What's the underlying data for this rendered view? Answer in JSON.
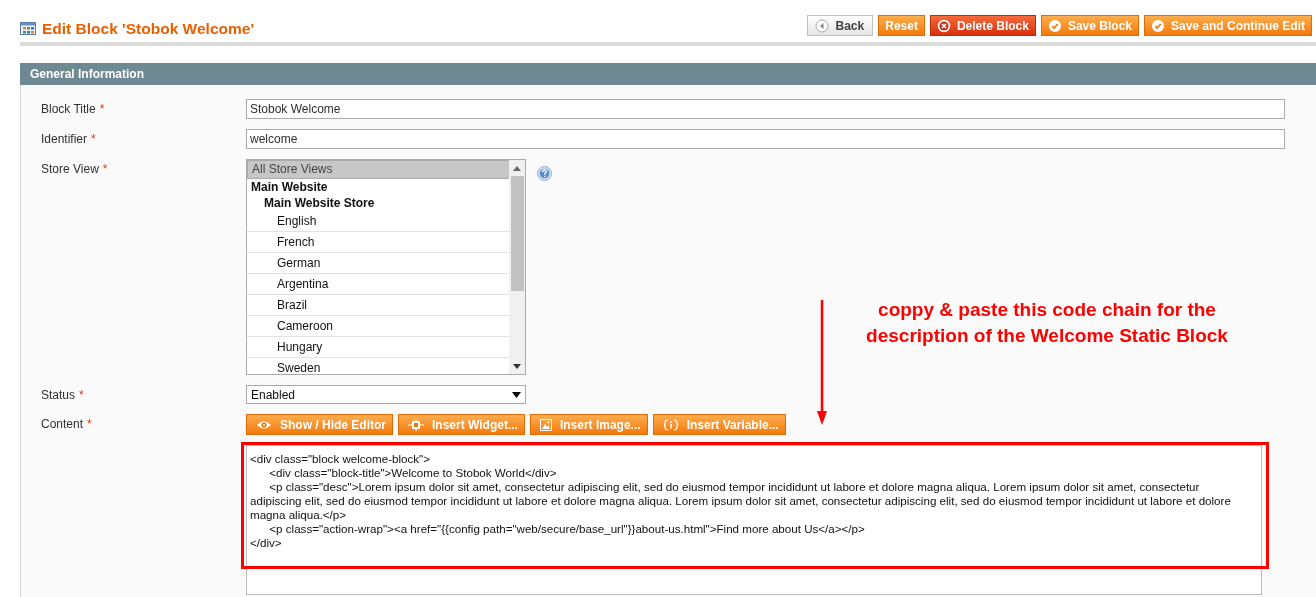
{
  "page_title": "Edit Block 'Stobok Welcome'",
  "actions": [
    {
      "label": "Back",
      "kind": "back"
    },
    {
      "label": "Reset",
      "kind": "plain"
    },
    {
      "label": "Delete Block",
      "kind": "delete"
    },
    {
      "label": "Save Block",
      "kind": "save"
    },
    {
      "label": "Save and Continue Edit",
      "kind": "save"
    }
  ],
  "section": {
    "title": "General Information"
  },
  "fields": [
    {
      "kind": "text",
      "label": "Block Title",
      "required_mark": "*",
      "value": "Stobok Welcome"
    },
    {
      "kind": "text",
      "label": "Identifier",
      "required_mark": "*",
      "value": "welcome"
    },
    {
      "kind": "multiselect",
      "label": "Store View",
      "required_mark": "*",
      "help": true,
      "options": [
        {
          "label": "All Store Views",
          "selected": true
        },
        {
          "label": "Main Website",
          "kind": "group",
          "children": [
            {
              "label": "Main Website Store",
              "kind": "group",
              "children": [
                {
                  "label": "English",
                  "selected": false
                },
                {
                  "label": "French",
                  "selected": false
                },
                {
                  "label": "German",
                  "selected": false
                },
                {
                  "label": "Argentina",
                  "selected": false
                },
                {
                  "label": "Brazil",
                  "selected": false
                },
                {
                  "label": "Cameroon",
                  "selected": false
                },
                {
                  "label": "Hungary",
                  "selected": false
                },
                {
                  "label": "Sweden",
                  "selected": false
                }
              ]
            }
          ]
        }
      ]
    },
    {
      "kind": "select",
      "label": "Status",
      "required_mark": "*",
      "value": "Enabled"
    },
    {
      "kind": "editor",
      "label": "Content",
      "required_mark": "*",
      "tools": [
        {
          "label": "Show / Hide Editor",
          "kind": "eye"
        },
        {
          "label": "Insert Widget...",
          "kind": "widget"
        },
        {
          "label": "Insert Image...",
          "kind": "image"
        },
        {
          "label": "Insert Variable...",
          "kind": "variable"
        }
      ],
      "value": "<div class=\"block welcome-block\">\n\t<div class=\"block-title\">Welcome to Stobok World</div>\n\t<p class=\"desc\">Lorem ipsum dolor sit amet, consectetur adipiscing elit, sed do eiusmod tempor incididunt ut labore et dolore magna aliqua. Lorem ipsum dolor sit amet, consectetur adipiscing elit, sed do eiusmod tempor incididunt ut labore et dolore magna aliqua. Lorem ipsum dolor sit amet, consectetur adipiscing elit, sed do eiusmod tempor incididunt ut labore et dolore magna aliqua.</p>\n\t<p class=\"action-wrap\"><a href=\"{{config path=\"web/secure/base_url\"}}about-us.html\">Find more about Us</a></p>\n</div>"
    }
  ],
  "annotation": {
    "text": "coppy & paste this code chain for the description of the Welcome Static Block"
  }
}
